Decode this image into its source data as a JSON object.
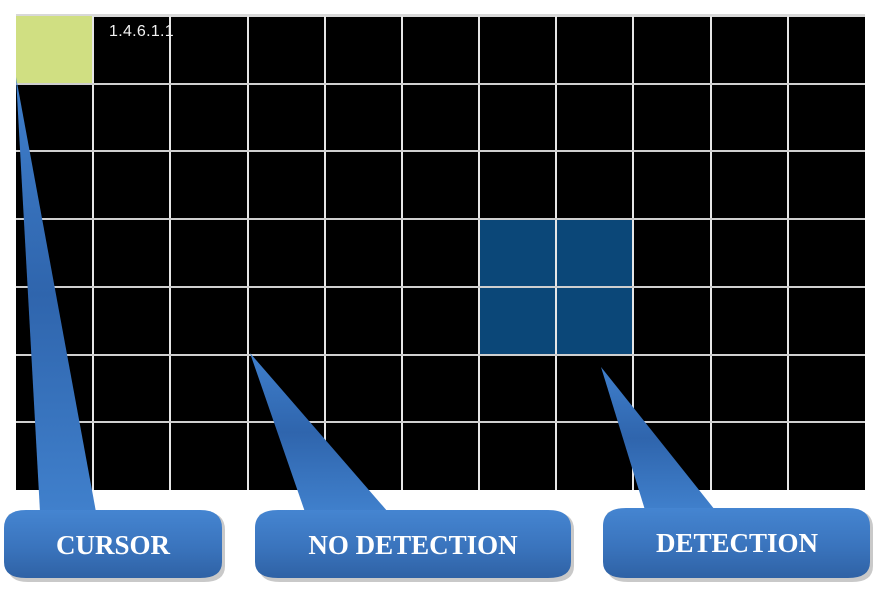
{
  "diagram": {
    "grid": {
      "rows": 7,
      "columns": 11,
      "background_color": "#000000",
      "line_color": "#e6e6e6",
      "cell_label": "1.4.6.1.1",
      "cursor_cell": {
        "row": 0,
        "col": 0,
        "color": "#d0df82"
      },
      "detection_cells": [
        {
          "row": 3,
          "col": 6
        },
        {
          "row": 3,
          "col": 7
        },
        {
          "row": 4,
          "col": 6
        },
        {
          "row": 4,
          "col": 7
        }
      ],
      "detection_color": "#0b4778"
    },
    "callouts": [
      {
        "id": "cursor",
        "label": "CURSOR",
        "points_to": "cursor cell"
      },
      {
        "id": "no-detection",
        "label": "NO DETECTION",
        "points_to": "empty cell"
      },
      {
        "id": "detection",
        "label": "DETECTION",
        "points_to": "detection cells"
      }
    ],
    "callout_color": "#3b78c2"
  }
}
